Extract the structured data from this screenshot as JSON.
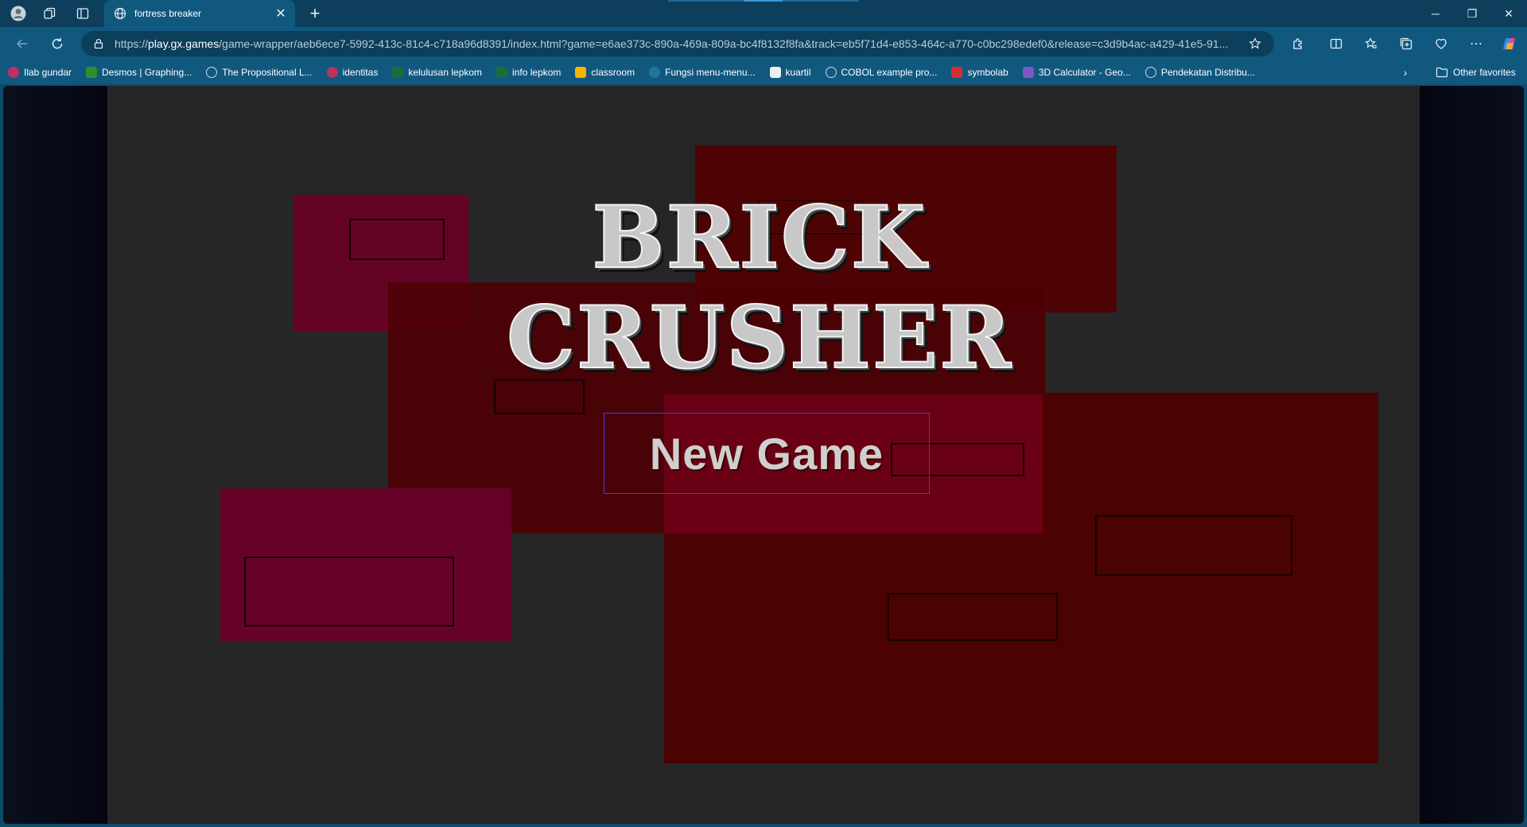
{
  "browser": {
    "tab": {
      "title": "fortress breaker"
    },
    "address": {
      "scheme": "https://",
      "host": "play.gx.games",
      "path": "/game-wrapper/aeb6ece7-5992-413c-81c4-c718a96d8391/index.html?game=e6ae373c-890a-469a-809a-bc4f8132f8fa&track=eb5f71d4-e853-464c-a770-c0bc298edef0&release=c3d9b4ac-a429-41e5-91..."
    },
    "bookmarks": [
      {
        "label": "Ilab gundar",
        "icon": "ilab-icon",
        "color": "#c03060"
      },
      {
        "label": "Desmos | Graphing...",
        "icon": "desmos-icon",
        "color": "#2f8f2f"
      },
      {
        "label": "The Propositional L...",
        "icon": "globe-icon",
        "color": "#cfd8dc"
      },
      {
        "label": "identitas",
        "icon": "ilab-icon",
        "color": "#c03060"
      },
      {
        "label": "kelulusan lepkom",
        "icon": "lepkom-icon",
        "color": "#1e6b3a"
      },
      {
        "label": "info lepkom",
        "icon": "lepkom-icon",
        "color": "#1e6b3a"
      },
      {
        "label": "classroom",
        "icon": "classroom-icon",
        "color": "#f4b400"
      },
      {
        "label": "Fungsi menu-menu...",
        "icon": "wordpress-icon",
        "color": "#21759b"
      },
      {
        "label": "kuartil",
        "icon": "doc-icon",
        "color": "#eceff1"
      },
      {
        "label": "COBOL example pro...",
        "icon": "globe-icon",
        "color": "#cfd8dc"
      },
      {
        "label": "symbolab",
        "icon": "symbolab-icon",
        "color": "#d32f2f"
      },
      {
        "label": "3D Calculator - Geo...",
        "icon": "geogebra-icon",
        "color": "#7e57c2"
      },
      {
        "label": "Pendekatan Distribu...",
        "icon": "globe-icon",
        "color": "#cfd8dc"
      }
    ],
    "other_favorites": "Other favorites"
  },
  "game": {
    "title": "BRICK CRUSHER",
    "menu": {
      "new_game": "New Game"
    },
    "colors": {
      "background": "#262626",
      "brick_dark_red": "#4a0000",
      "brick_red": "#5e0010",
      "brick_crimson": "#640428",
      "title_text": "#c8c8c8",
      "button_border": "#3f3fe0"
    }
  }
}
